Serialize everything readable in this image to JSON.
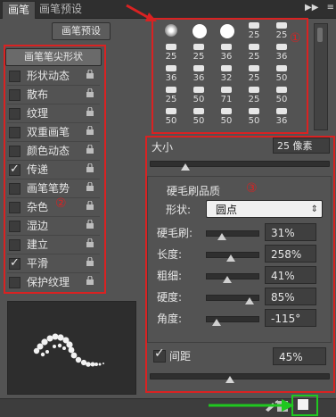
{
  "tabs": {
    "tab1": "画笔",
    "tab2": "画笔预设"
  },
  "topbar": {
    "icons": [
      "expand-icon",
      "menu-icon"
    ]
  },
  "preset_button": "画笔预设",
  "left": {
    "header": "画笔笔尖形状",
    "items": [
      {
        "label": "形状动态",
        "checked": false
      },
      {
        "label": "散布",
        "checked": false
      },
      {
        "label": "纹理",
        "checked": false
      },
      {
        "label": "双重画笔",
        "checked": false
      },
      {
        "label": "颜色动态",
        "checked": false
      },
      {
        "label": "传递",
        "checked": true
      },
      {
        "label": "画笔笔势",
        "checked": false
      },
      {
        "label": "杂色",
        "checked": false
      },
      {
        "label": "湿边",
        "checked": false
      },
      {
        "label": "建立",
        "checked": false
      },
      {
        "label": "平滑",
        "checked": true
      },
      {
        "label": "保护纹理",
        "checked": false
      }
    ],
    "annotation": "②"
  },
  "brushes": {
    "annotation": "①",
    "numbers": [
      [
        "",
        "",
        "",
        "25",
        "25"
      ],
      [
        "25",
        "25",
        "36",
        "25",
        "36"
      ],
      [
        "36",
        "36",
        "32",
        "25",
        "50"
      ],
      [
        "25",
        "50",
        "71",
        "25",
        "50"
      ],
      [
        "50",
        "50",
        "50",
        "50",
        "36"
      ]
    ]
  },
  "size": {
    "label": "大小",
    "value": "25 像素",
    "level": 0.2
  },
  "quality": {
    "title": "硬毛刷品质",
    "annotation": "③",
    "shape_label": "形状:",
    "shape_value": "圆点",
    "params": [
      {
        "label": "硬毛刷:",
        "value": "31%",
        "level": 0.31
      },
      {
        "label": "长度:",
        "value": "258%",
        "level": 0.48
      },
      {
        "label": "粗细:",
        "value": "41%",
        "level": 0.41
      },
      {
        "label": "硬度:",
        "value": "85%",
        "level": 0.85
      },
      {
        "label": "角度:",
        "value": "-115°",
        "level": 0.2
      }
    ]
  },
  "spacing": {
    "label": "间距",
    "value": "45%",
    "checked": true,
    "level": 0.45
  },
  "colors": {
    "accent_red": "#d92222",
    "accent_green": "#20c820"
  }
}
